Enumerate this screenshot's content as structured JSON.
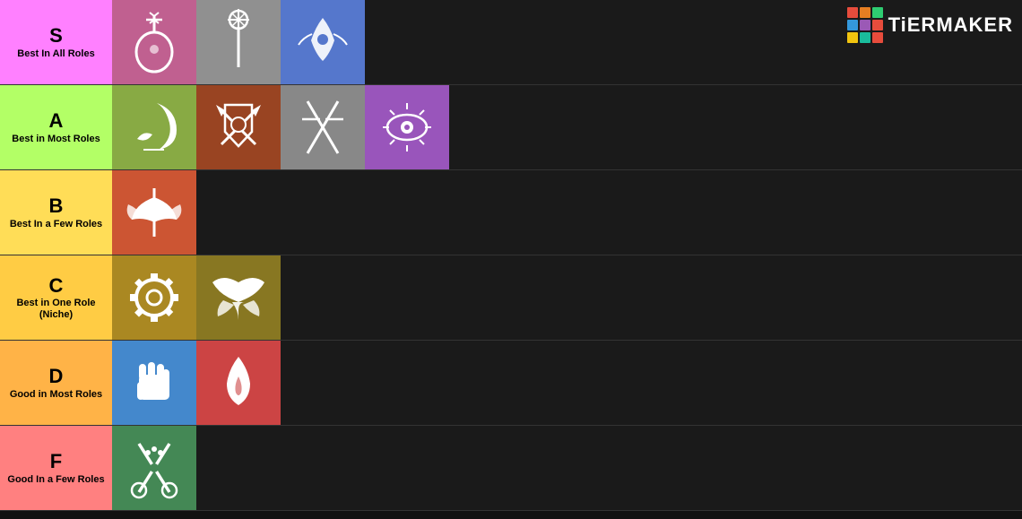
{
  "tiers": [
    {
      "id": "s",
      "letter": "S",
      "subtitle": "Best In All Roles",
      "color": "#ff80ff",
      "items": [
        {
          "id": "s1",
          "bg": "#c06090",
          "symbol": "lute"
        },
        {
          "id": "s2",
          "bg": "#909090",
          "symbol": "staff"
        },
        {
          "id": "s3",
          "bg": "#5577cc",
          "symbol": "magic"
        }
      ]
    },
    {
      "id": "a",
      "letter": "A",
      "subtitle": "Best in Most Roles",
      "color": "#b3ff66",
      "items": [
        {
          "id": "a1",
          "bg": "#88aa44",
          "symbol": "sickle"
        },
        {
          "id": "a2",
          "bg": "#994422",
          "symbol": "swordshield"
        },
        {
          "id": "a3",
          "bg": "#888888",
          "symbol": "dualswords"
        },
        {
          "id": "a4",
          "bg": "#9955bb",
          "symbol": "eye"
        }
      ]
    },
    {
      "id": "b",
      "letter": "B",
      "subtitle": "Best In a Few Roles",
      "color": "#ffdd57",
      "items": [
        {
          "id": "b1",
          "bg": "#cc5533",
          "symbol": "axe"
        }
      ]
    },
    {
      "id": "c",
      "letter": "C",
      "subtitle": "Best in One Role (Niche)",
      "color": "#ffcc44",
      "items": [
        {
          "id": "c1",
          "bg": "#aa8822",
          "symbol": "gear"
        },
        {
          "id": "c2",
          "bg": "#887722",
          "symbol": "wings"
        }
      ]
    },
    {
      "id": "d",
      "letter": "D",
      "subtitle": "Good in Most Roles",
      "color": "#ffb347",
      "items": [
        {
          "id": "d1",
          "bg": "#4488cc",
          "symbol": "fist"
        },
        {
          "id": "d2",
          "bg": "#cc4444",
          "symbol": "flame"
        }
      ]
    },
    {
      "id": "f",
      "letter": "F",
      "subtitle": "Good In a Few Roles",
      "color": "#ff8080",
      "items": [
        {
          "id": "f1",
          "bg": "#448855",
          "symbol": "scissors"
        }
      ]
    }
  ],
  "logo": {
    "text": "TiERMAKER",
    "grid_colors": [
      "#e74c3c",
      "#e67e22",
      "#2ecc71",
      "#3498db",
      "#9b59b6",
      "#e74c3c",
      "#f1c40f",
      "#1abc9c",
      "#e74c3c"
    ]
  }
}
